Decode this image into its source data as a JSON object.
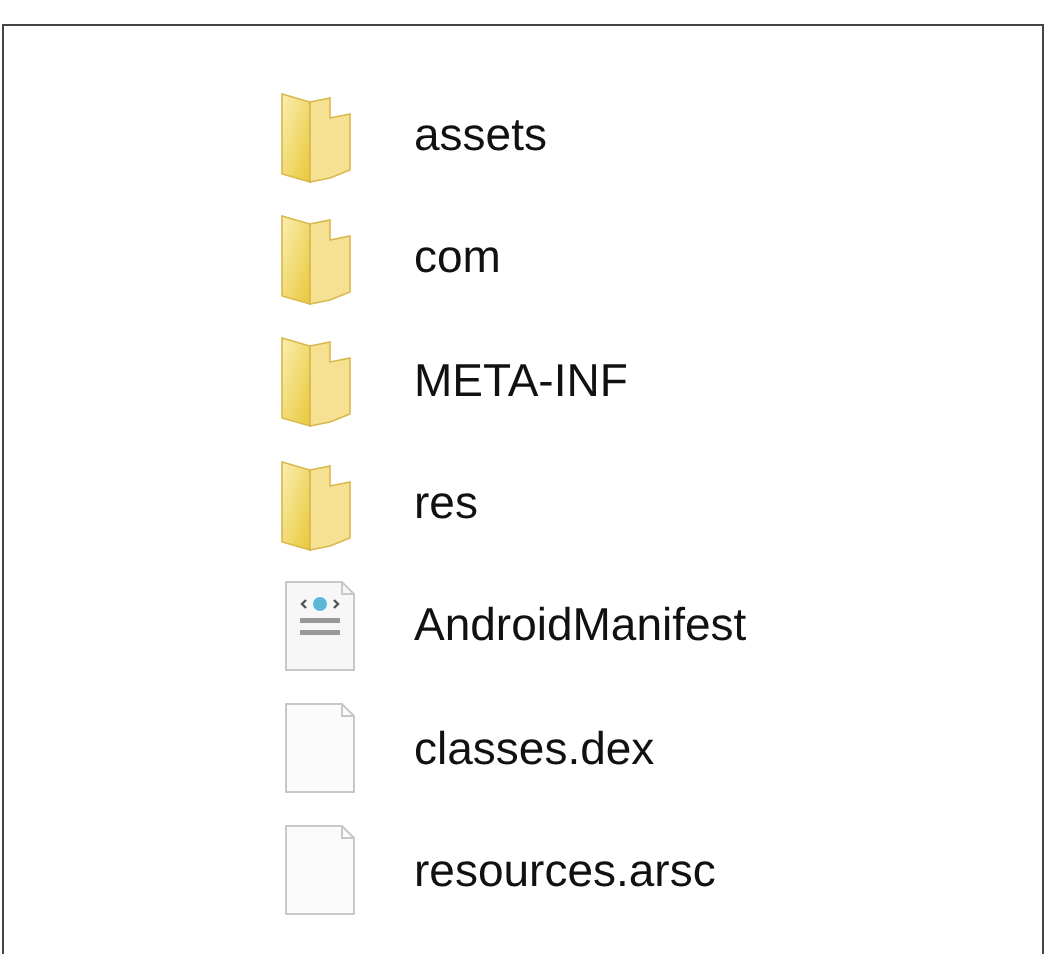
{
  "files": [
    {
      "name": "assets",
      "kind": "folder"
    },
    {
      "name": "com",
      "kind": "folder"
    },
    {
      "name": "META-INF",
      "kind": "folder"
    },
    {
      "name": "res",
      "kind": "folder"
    },
    {
      "name": "AndroidManifest",
      "kind": "manifest"
    },
    {
      "name": "classes.dex",
      "kind": "file"
    },
    {
      "name": "resources.arsc",
      "kind": "file"
    }
  ]
}
